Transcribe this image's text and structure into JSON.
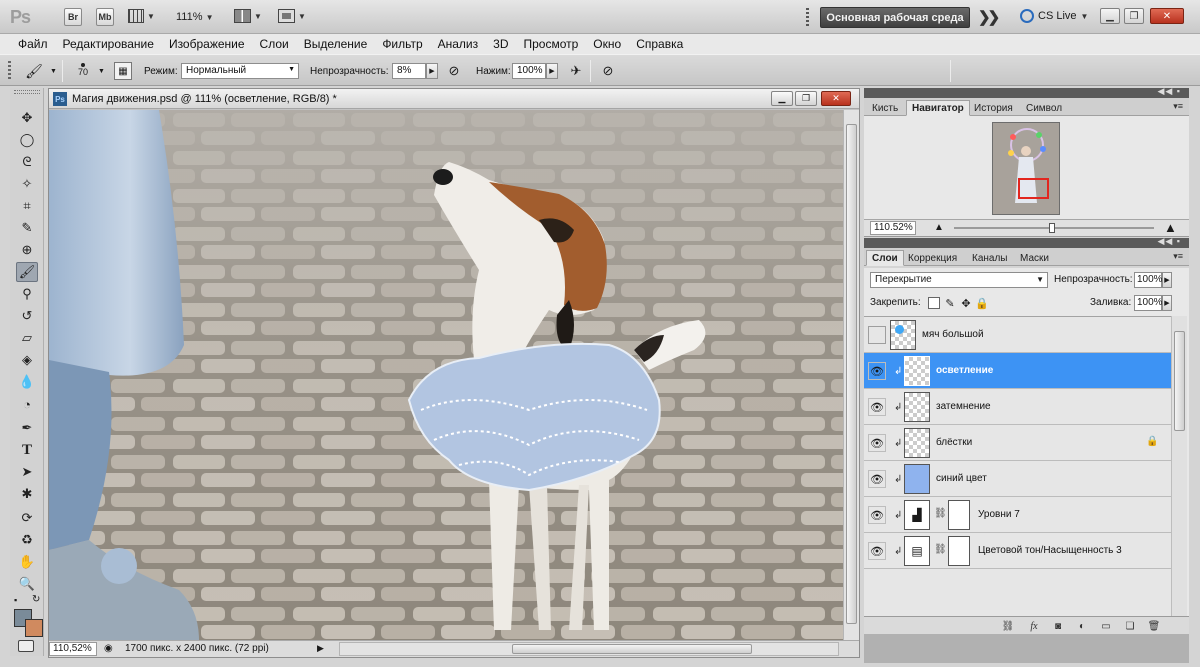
{
  "app": {
    "logo": "Ps",
    "bridge_btn": "Br",
    "minibridge_btn": "Mb",
    "zoom_level": "111%",
    "workspace": "Основная рабочая среда",
    "cslive": "CS Live"
  },
  "menu": [
    "Файл",
    "Редактирование",
    "Изображение",
    "Слои",
    "Выделение",
    "Фильтр",
    "Анализ",
    "3D",
    "Просмотр",
    "Окно",
    "Справка"
  ],
  "options": {
    "brush_size": "70",
    "mode_label": "Режим:",
    "mode_value": "Нормальный",
    "opacity_label": "Непрозрачность:",
    "opacity_value": "8%",
    "pressure_label": "Нажим:",
    "pressure_value": "100%"
  },
  "document": {
    "title": "Магия движения.psd @ 111% (осветление, RGB/8) *",
    "status_zoom": "110,52%",
    "status_info": "1700 пикс. x 2400 пикс. (72 ppi)"
  },
  "nav_panel": {
    "tabs": [
      "Кисть",
      "Навигатор",
      "История",
      "Символ"
    ],
    "active_tab": "Навигатор",
    "zoom": "110.52%"
  },
  "layers_panel": {
    "tabs": [
      "Слои",
      "Коррекция",
      "Каналы",
      "Маски"
    ],
    "active_tab": "Слои",
    "blend_mode": "Перекрытие",
    "opacity_label": "Непрозрачность:",
    "opacity_value": "100%",
    "lock_label": "Закрепить:",
    "fill_label": "Заливка:",
    "fill_value": "100%",
    "layers": [
      {
        "name": "мяч большой",
        "visible": false,
        "selected": false
      },
      {
        "name": "осветление",
        "visible": true,
        "selected": true
      },
      {
        "name": "затемнение",
        "visible": true,
        "selected": false
      },
      {
        "name": "блёстки",
        "visible": true,
        "selected": false
      },
      {
        "name": "синий цвет",
        "visible": true,
        "selected": false
      },
      {
        "name": "Уровни 7",
        "visible": true,
        "selected": false
      },
      {
        "name": "Цветовой тон/Насыщенность 3",
        "visible": true,
        "selected": false
      }
    ]
  },
  "colors": {
    "selection": "#3d93f4",
    "foreground": "#7a8b99",
    "background": "#d08a5f",
    "blue_fill": "#8fb3ee"
  }
}
